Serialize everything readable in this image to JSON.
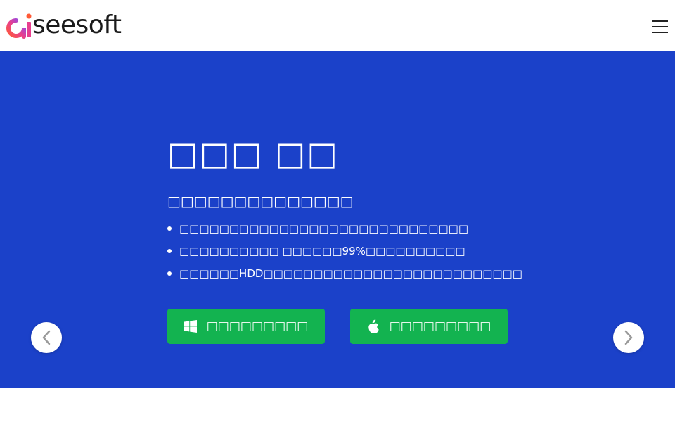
{
  "header": {
    "logo_text": "seesoft",
    "logo_icon": "aiseesoft-logo-icon",
    "menu_icon": "hamburger-menu-icon"
  },
  "hero": {
    "title": "□□□ □□",
    "subtitle": "□□□□□□□□□□□□□□",
    "features": [
      "□□□□□□□□□□□□□□□□□□□□□□□□□□□□□",
      "□□□□□□□□□□ □□□□□□99%□□□□□□□□□□",
      "□□□□□□HDD□□□□□□□□□□□□□□□□□□□□□□□□□□"
    ],
    "download_windows_label": "□□□□□□□□□",
    "download_mac_label": "□□□□□□□□□",
    "prev_icon": "chevron-left-icon",
    "next_icon": "chevron-right-icon"
  },
  "colors": {
    "hero_background": "#1b41c9",
    "button_green": "#13b350",
    "logo_text": "#1a1a1a"
  }
}
